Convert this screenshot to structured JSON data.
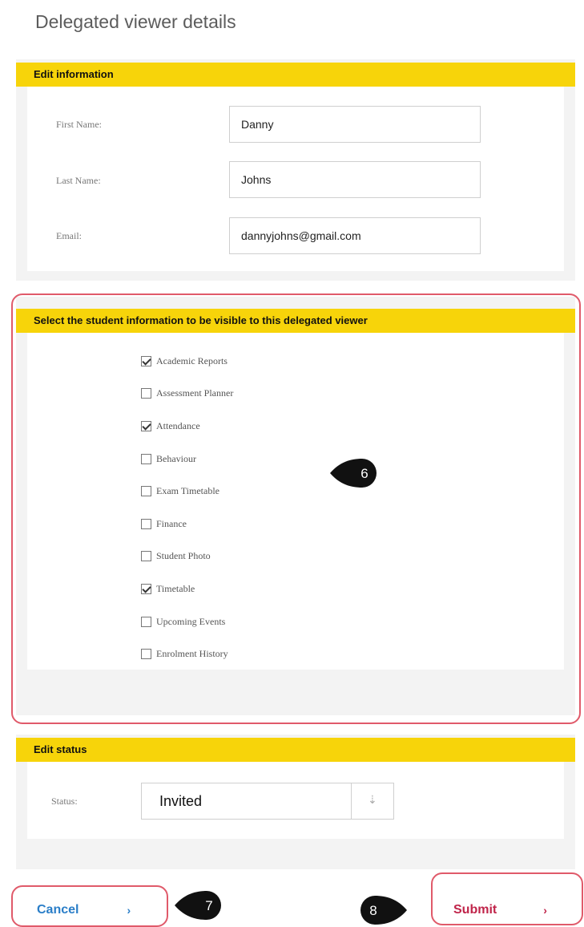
{
  "page_title": "Delegated viewer details",
  "edit_information": {
    "header": "Edit information",
    "fields": [
      {
        "label": "First Name:",
        "value": "Danny"
      },
      {
        "label": "Last Name:",
        "value": "Johns"
      },
      {
        "label": "Email:",
        "value": "dannyjohns@gmail.com"
      }
    ]
  },
  "visibility": {
    "header": "Select the student information to be visible to this delegated viewer",
    "options": [
      {
        "label": "Academic Reports",
        "checked": true
      },
      {
        "label": "Assessment Planner",
        "checked": false
      },
      {
        "label": "Attendance",
        "checked": true
      },
      {
        "label": "Behaviour",
        "checked": false
      },
      {
        "label": "Exam Timetable",
        "checked": false
      },
      {
        "label": "Finance",
        "checked": false
      },
      {
        "label": "Student Photo",
        "checked": false
      },
      {
        "label": "Timetable",
        "checked": true
      },
      {
        "label": "Upcoming Events",
        "checked": false
      },
      {
        "label": "Enrolment History",
        "checked": false
      }
    ]
  },
  "edit_status": {
    "header": "Edit status",
    "label": "Status:",
    "selected": "Invited"
  },
  "buttons": {
    "cancel_label": "Cancel",
    "cancel_arrow": "›",
    "submit_label": "Submit",
    "submit_arrow": "›"
  },
  "callouts": {
    "marker_6": "6",
    "marker_7": "7",
    "marker_8": "8"
  },
  "colors": {
    "header_yellow": "#f7d40a",
    "highlight_frame": "#e05a6a",
    "cancel_text": "#2a7ec8",
    "submit_text": "#c0244a",
    "marker_fill": "#111111"
  }
}
